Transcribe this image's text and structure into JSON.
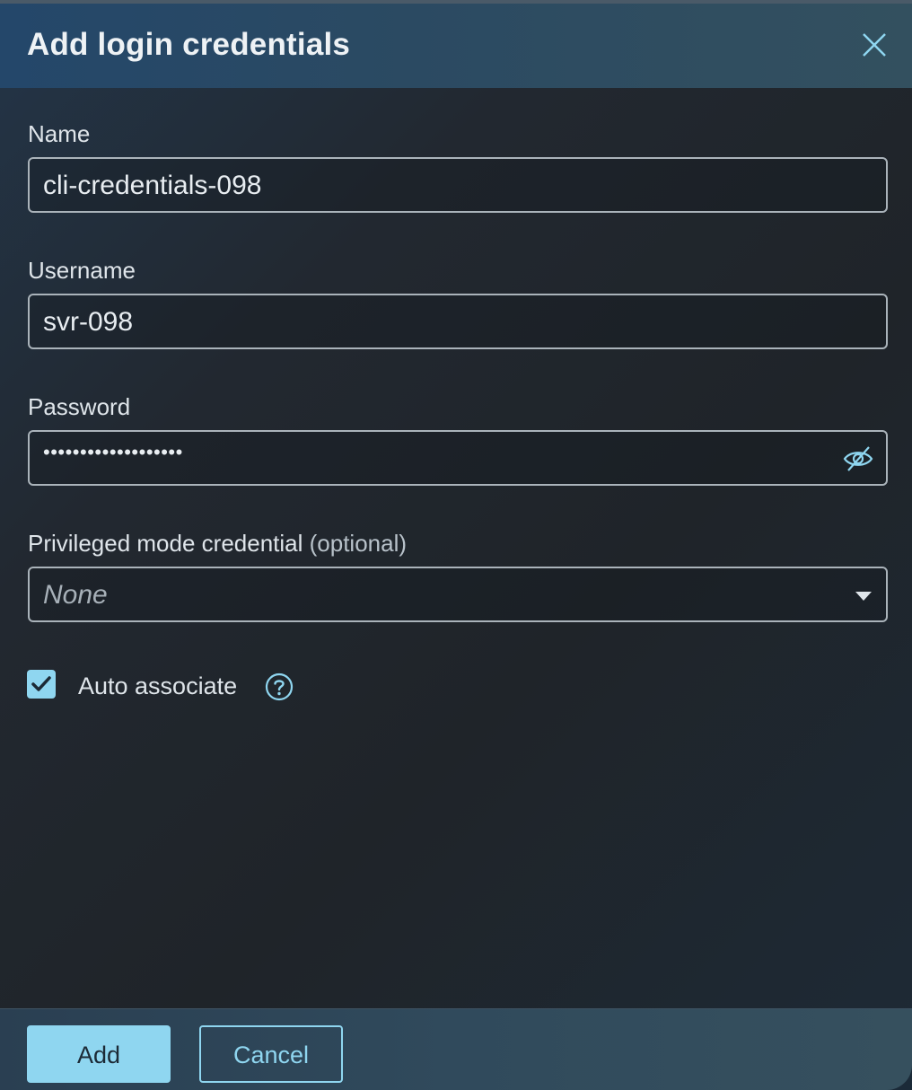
{
  "dialog": {
    "title": "Add login credentials"
  },
  "form": {
    "name": {
      "label": "Name",
      "value": "cli-credentials-098"
    },
    "username": {
      "label": "Username",
      "value": "svr-098"
    },
    "password": {
      "label": "Password",
      "masked_value": "•••••••••••••••••••"
    },
    "privileged": {
      "label": "Privileged mode credential",
      "optional_hint": "(optional)",
      "selected": "None"
    },
    "auto_associate": {
      "label": "Auto associate",
      "checked": true
    }
  },
  "footer": {
    "add_label": "Add",
    "cancel_label": "Cancel"
  },
  "colors": {
    "accent": "#8fd6f0",
    "header_bg": "#24476a",
    "body_bg": "#1f2429"
  }
}
